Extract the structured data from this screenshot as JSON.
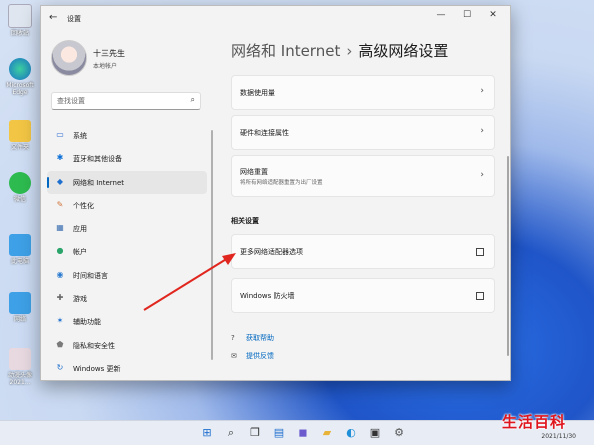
{
  "desktop": {
    "icons": [
      {
        "label": "回收站"
      },
      {
        "label": "Microsoft Edge"
      },
      {
        "label": "文件夹"
      },
      {
        "label": "微信"
      },
      {
        "label": "此电脑"
      },
      {
        "label": "网络"
      },
      {
        "label": "动漫头像2021..."
      }
    ]
  },
  "window": {
    "title": "设置",
    "back_glyph": "←",
    "controls": {
      "minimize": "—",
      "maximize": "☐",
      "close": "✕"
    }
  },
  "profile": {
    "name": "十三先生",
    "account": "本地帐户"
  },
  "search": {
    "placeholder": "查找设置",
    "icon": "search-icon"
  },
  "nav": {
    "items": [
      {
        "label": "系统",
        "icon": "monitor-icon",
        "glyph": "▭",
        "color": "#2d6bd1"
      },
      {
        "label": "蓝牙和其他设备",
        "icon": "bluetooth-icon",
        "glyph": "✱",
        "color": "#0a6fd8"
      },
      {
        "label": "网络和 Internet",
        "icon": "wifi-icon",
        "glyph": "◆",
        "color": "#1f6fce",
        "active": true
      },
      {
        "label": "个性化",
        "icon": "brush-icon",
        "glyph": "✎",
        "color": "#d0743a"
      },
      {
        "label": "应用",
        "icon": "apps-icon",
        "glyph": "▦",
        "color": "#3a6fb0"
      },
      {
        "label": "帐户",
        "icon": "account-icon",
        "glyph": "●",
        "color": "#2aa46a"
      },
      {
        "label": "时间和语言",
        "icon": "globe-icon",
        "glyph": "◉",
        "color": "#2b7bd0"
      },
      {
        "label": "游戏",
        "icon": "gamepad-icon",
        "glyph": "✚",
        "color": "#666666"
      },
      {
        "label": "辅助功能",
        "icon": "accessibility-icon",
        "glyph": "✶",
        "color": "#1f6fce"
      },
      {
        "label": "隐私和安全性",
        "icon": "shield-icon",
        "glyph": "⬟",
        "color": "#7a7a7a"
      },
      {
        "label": "Windows 更新",
        "icon": "update-icon",
        "glyph": "↻",
        "color": "#1f6fce"
      }
    ]
  },
  "breadcrumb": {
    "parent": "网络和 Internet",
    "separator": "›",
    "current": "高级网络设置"
  },
  "cards": [
    {
      "title": "数据使用量",
      "subtitle": "",
      "action": "chevron-right-icon",
      "glyph": "›"
    },
    {
      "title": "硬件和连接属性",
      "subtitle": "",
      "action": "chevron-right-icon",
      "glyph": "›"
    },
    {
      "title": "网络重置",
      "subtitle": "将所有网络适配器重置为出厂设置",
      "action": "chevron-right-icon",
      "glyph": "›"
    }
  ],
  "related": {
    "heading": "相关设置",
    "items": [
      {
        "title": "更多网络适配器选项",
        "action": "external-link-icon"
      },
      {
        "title": "Windows 防火墙",
        "action": "external-link-icon"
      }
    ]
  },
  "help_links": [
    {
      "label": "获取帮助",
      "icon": "help-icon",
      "glyph": "?"
    },
    {
      "label": "提供反馈",
      "icon": "feedback-icon",
      "glyph": "✉"
    }
  ],
  "taskbar": {
    "icons": [
      {
        "name": "start-icon",
        "glyph": "⊞",
        "color": "#1f6fce"
      },
      {
        "name": "search-icon",
        "glyph": "⌕",
        "color": "#333333"
      },
      {
        "name": "task-view-icon",
        "glyph": "❐",
        "color": "#333333"
      },
      {
        "name": "widgets-icon",
        "glyph": "▤",
        "color": "#1f6fce"
      },
      {
        "name": "chat-icon",
        "glyph": "◼",
        "color": "#6a5acd"
      },
      {
        "name": "explorer-icon",
        "glyph": "▰",
        "color": "#e8b339"
      },
      {
        "name": "edge-icon",
        "glyph": "◐",
        "color": "#1f8fd8"
      },
      {
        "name": "store-icon",
        "glyph": "▣",
        "color": "#333333"
      },
      {
        "name": "settings-icon",
        "glyph": "⚙",
        "color": "#555555"
      }
    ],
    "date": "2021/11/30"
  },
  "watermark": "生活百科",
  "colors": {
    "accent": "#0067c0",
    "arrow": "#e0261e"
  }
}
